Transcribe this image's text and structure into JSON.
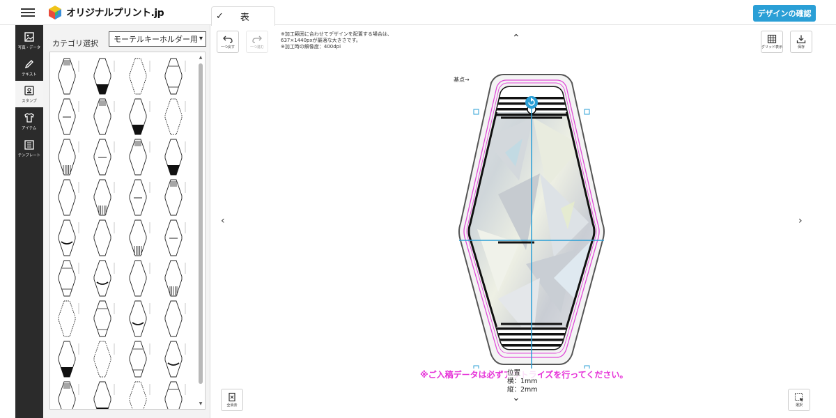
{
  "header": {
    "logo_text": "オリジナルプリント.jp",
    "tab_label": "表",
    "tab_check": "✓",
    "confirm_label": "デザインの確認"
  },
  "sidebar": {
    "items": [
      {
        "label": "写真・データ",
        "icon": "image-icon"
      },
      {
        "label": "テキスト",
        "icon": "pen-icon"
      },
      {
        "label": "スタンプ",
        "icon": "stamp-icon"
      },
      {
        "label": "アイテム",
        "icon": "shirt-icon"
      },
      {
        "label": "テンプレート",
        "icon": "template-icon"
      }
    ],
    "active_index": 2
  },
  "panel": {
    "title": "カテゴリ選択",
    "category_value": "モーテルキーホルダー用"
  },
  "toolbar": {
    "undo_label": "一つ戻す",
    "redo_label": "一つ進む",
    "grid_label": "グリッド表示",
    "save_label": "保存",
    "clear_label": "全消去",
    "select_label": "選択"
  },
  "canvas": {
    "note_line1": "※加工範囲に合わせてデザインを配置する場合は、",
    "note_line2": "637×1440pxが最適な大きさです。",
    "note_line3": "※加工時の解像度：400dpi",
    "origin_label": "基点→",
    "warning": "※ご入稿データは必ずアウトライズを行ってください。",
    "pos_title": "位置",
    "pos_x": "横：1mm",
    "pos_y": "縦：2mm"
  },
  "colors": {
    "accent": "#2a9fd6",
    "warning": "#e633d8",
    "sidebar_bg": "#2b2b2b"
  }
}
